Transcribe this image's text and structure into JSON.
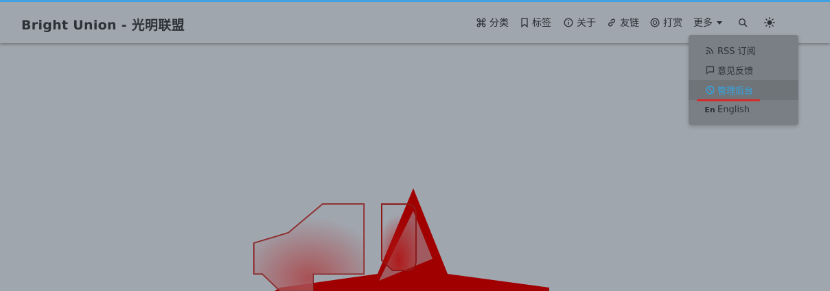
{
  "site": {
    "title": "Bright Union - 光明联盟"
  },
  "nav": {
    "categories": "分类",
    "tags": "标签",
    "about": "关于",
    "links": "友链",
    "donate": "打赏",
    "more": "更多"
  },
  "more_menu": {
    "items": [
      {
        "label": "RSS 订阅",
        "icon": "rss-icon"
      },
      {
        "label": "意见反馈",
        "icon": "feedback-icon"
      },
      {
        "label": "管理后台",
        "icon": "admin-icon",
        "active": true
      },
      {
        "label": "English",
        "icon": "language-en-icon"
      }
    ]
  },
  "icons": {
    "search": "search-icon",
    "theme": "sun-icon"
  },
  "colors": {
    "accent": "#42a3e6",
    "active_item": "#33a6e6",
    "highlight_underline": "#d42b2b",
    "hero_star": "#a00000"
  }
}
